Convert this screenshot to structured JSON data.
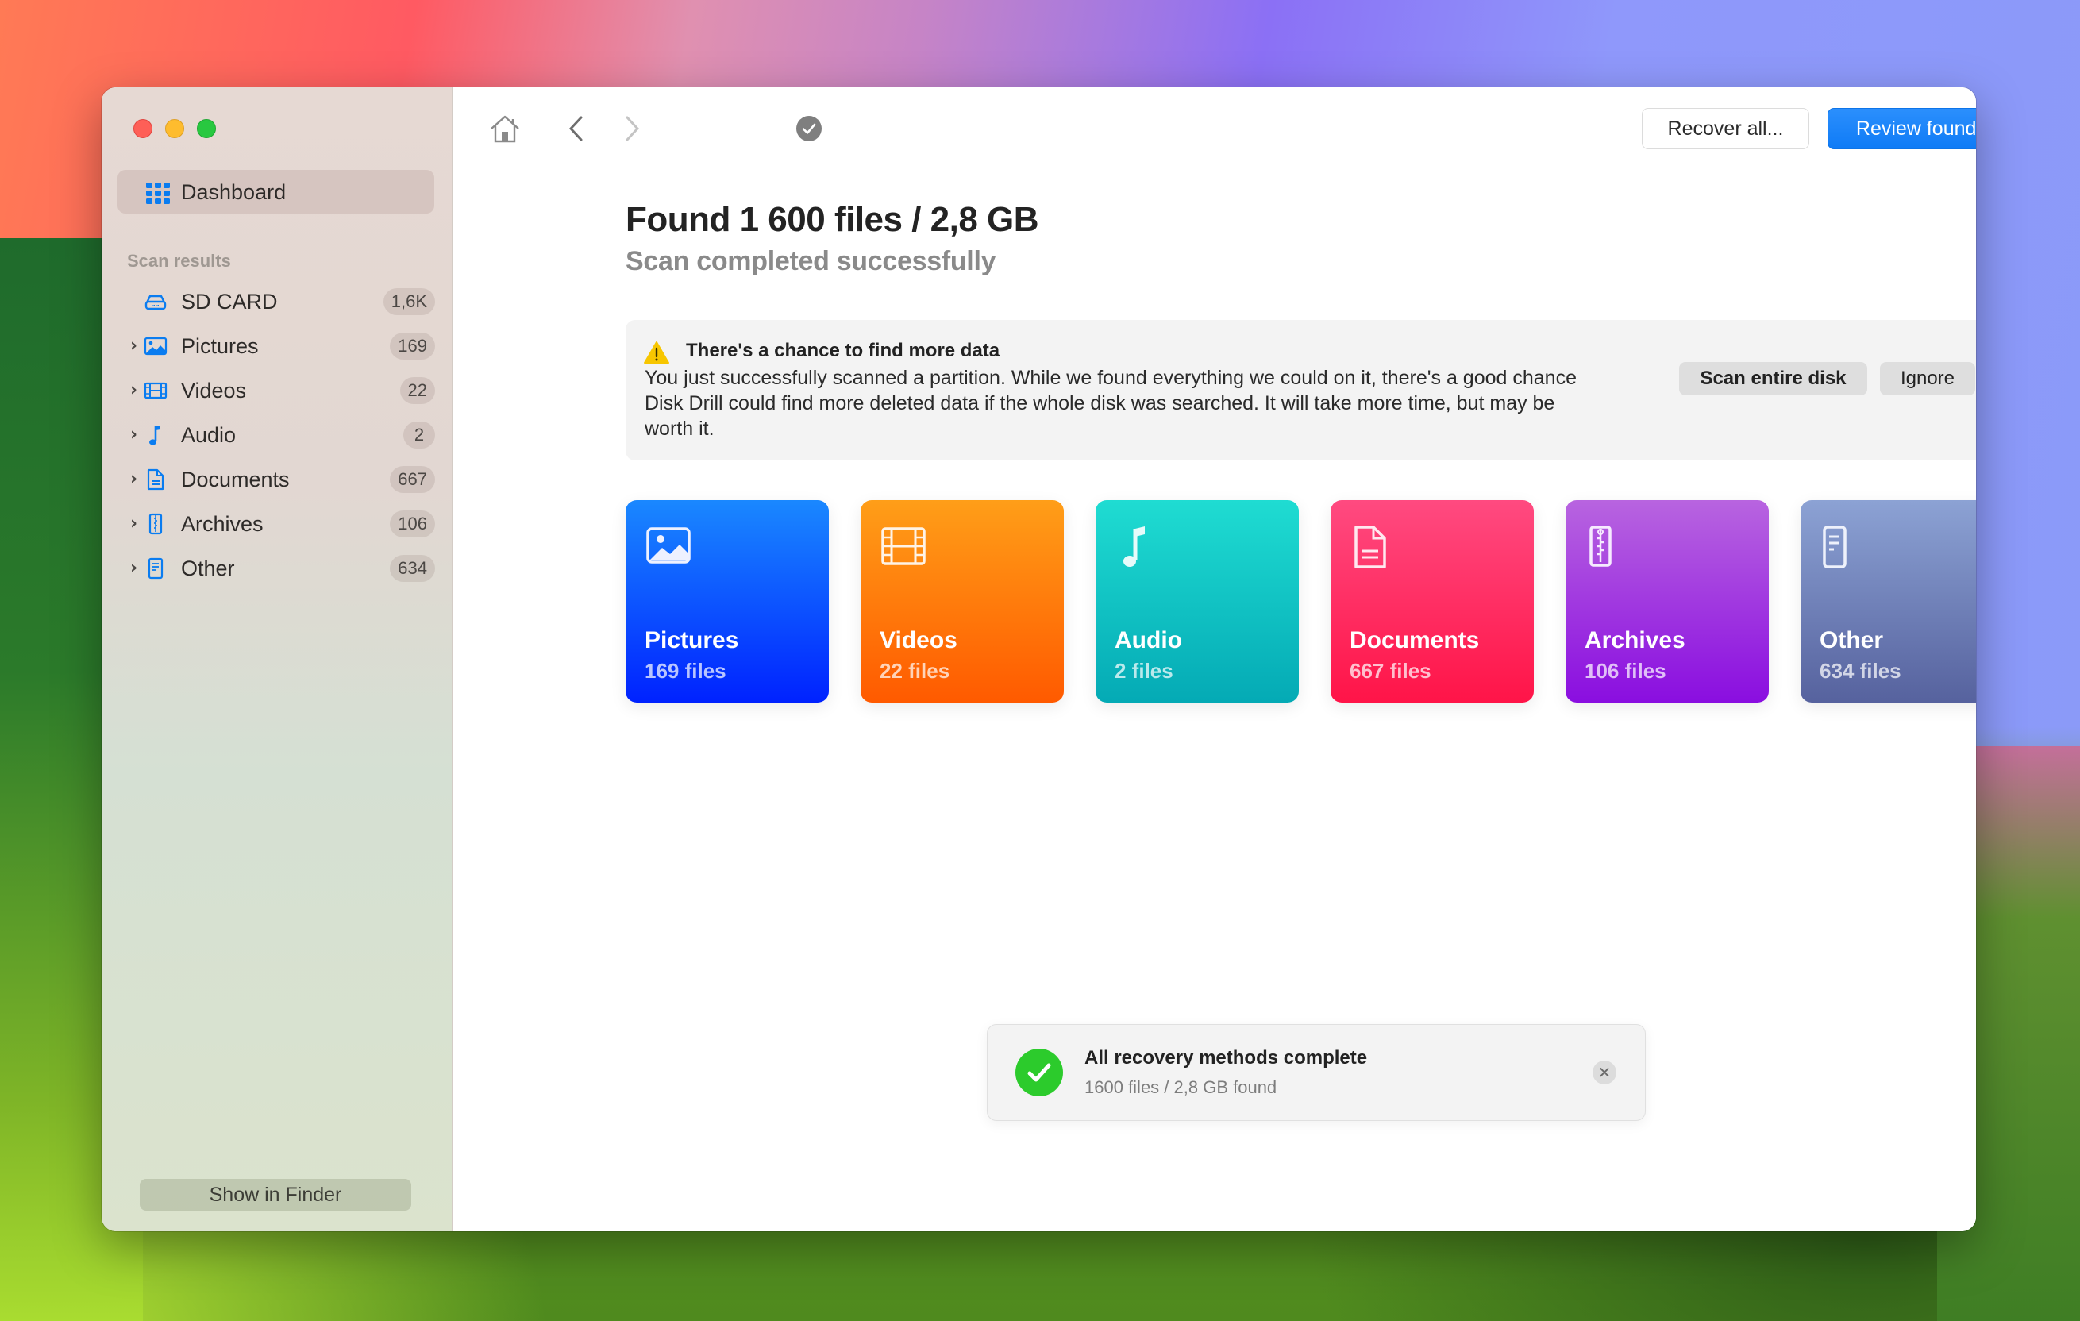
{
  "window": {
    "traffic_lights": [
      "close",
      "minimize",
      "zoom"
    ]
  },
  "sidebar": {
    "dashboard": {
      "label": "Dashboard",
      "icon": "grid-icon",
      "selected": true
    },
    "section_label": "Scan results",
    "device": {
      "label": "SD CARD",
      "count": "1,6K",
      "icon": "drive-icon"
    },
    "items": [
      {
        "label": "Pictures",
        "count": "169",
        "icon": "picture-icon"
      },
      {
        "label": "Videos",
        "count": "22",
        "icon": "film-icon"
      },
      {
        "label": "Audio",
        "count": "2",
        "icon": "music-note-icon"
      },
      {
        "label": "Documents",
        "count": "667",
        "icon": "document-icon"
      },
      {
        "label": "Archives",
        "count": "106",
        "icon": "archive-icon"
      },
      {
        "label": "Other",
        "count": "634",
        "icon": "file-icon"
      }
    ],
    "show_in_finder": "Show in Finder"
  },
  "toolbar": {
    "icons": [
      "home-icon",
      "back-icon",
      "forward-icon",
      "status-check-icon"
    ],
    "recover_all": "Recover all...",
    "review_found": "Review found items"
  },
  "main": {
    "title": "Found 1 600 files / 2,8 GB",
    "subtitle": "Scan completed successfully",
    "banner": {
      "title": "There's a chance to find more data",
      "text": "You just successfully scanned a partition. While we found everything we could on it, there's a good chance Disk Drill could find more deleted data if the whole disk was searched. It will take more time, but may be worth it.",
      "scan_button": "Scan entire disk",
      "ignore_button": "Ignore"
    },
    "cards": [
      {
        "name": "Pictures",
        "count": "169 files",
        "from": "#1a88ff",
        "to": "#0022ff"
      },
      {
        "name": "Videos",
        "count": "22 files",
        "from": "#ff9e18",
        "to": "#ff5a00"
      },
      {
        "name": "Audio",
        "count": "2 files",
        "from": "#1fdcd2",
        "to": "#04aab5"
      },
      {
        "name": "Documents",
        "count": "667 files",
        "from": "#ff4a80",
        "to": "#ff1448"
      },
      {
        "name": "Archives",
        "count": "106 files",
        "from": "#b864e0",
        "to": "#8a0ee0"
      },
      {
        "name": "Other",
        "count": "634 files",
        "from": "#8ca2d4",
        "to": "#56629e"
      }
    ]
  },
  "toast": {
    "title": "All recovery methods complete",
    "subtitle": "1600 files / 2,8 GB found"
  },
  "colors": {
    "accent": "#0f7bf6",
    "success": "#2ccb2c",
    "warning": "#f7c600",
    "sidebar_icon": "#0a7cf0"
  }
}
